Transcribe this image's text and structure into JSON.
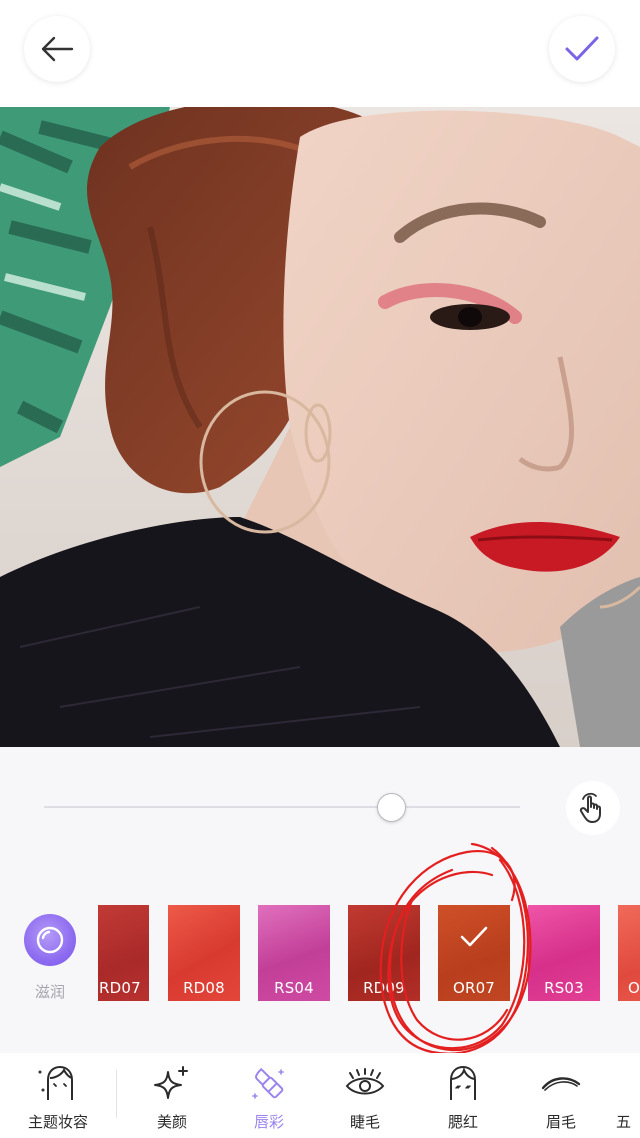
{
  "header": {
    "back_icon": "arrow-left-icon",
    "confirm_icon": "checkmark-icon",
    "accent": "#7b63e6"
  },
  "photo": {
    "subject": "selfie-with-red-lipstick"
  },
  "controls": {
    "intensity": 0.73,
    "compare_icon": "touch-hand-icon"
  },
  "finish": {
    "label": "滋润",
    "icon": "lens-circle-icon"
  },
  "swatches": [
    {
      "code": "RD07",
      "color": "#b8312f",
      "selected": false
    },
    {
      "code": "RD08",
      "color": "#e4463a",
      "selected": false
    },
    {
      "code": "RS04",
      "color": "#cf4aa3",
      "selected": false
    },
    {
      "code": "RD09",
      "color": "#b32e27",
      "selected": false
    },
    {
      "code": "OR07",
      "color": "#c24623",
      "selected": true
    },
    {
      "code": "RS03",
      "color": "#e23f95",
      "selected": false
    },
    {
      "code": "OR",
      "color": "#ec5a4c",
      "selected": false
    }
  ],
  "tabs": [
    {
      "label": "主题妆容",
      "icon": "face-makeup-icon",
      "active": false
    },
    {
      "label": "美颜",
      "icon": "sparkle-icon",
      "active": false
    },
    {
      "label": "唇彩",
      "icon": "lipstick-icon",
      "active": true
    },
    {
      "label": "睫毛",
      "icon": "eyelash-icon",
      "active": false
    },
    {
      "label": "腮红",
      "icon": "blush-face-icon",
      "active": false
    },
    {
      "label": "眉毛",
      "icon": "eyebrow-icon",
      "active": false
    },
    {
      "label": "五",
      "icon": "",
      "active": false
    }
  ]
}
